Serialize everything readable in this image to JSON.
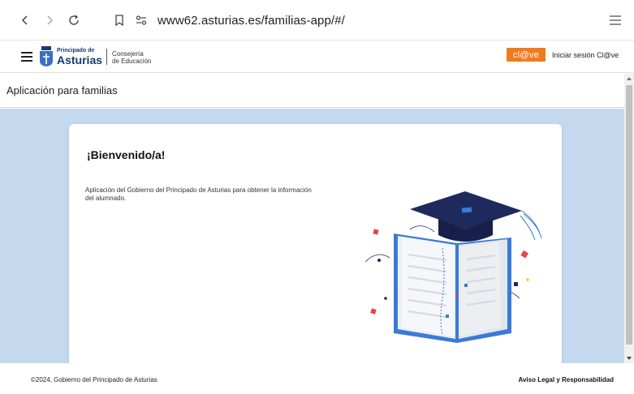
{
  "browser": {
    "url": "www62.asturias.es/familias-app/#/"
  },
  "header": {
    "logo_small": "Principado de",
    "logo_big": "Asturias",
    "department_line1": "Consejería",
    "department_line2": "de Educación",
    "clave_logo": "cl@ve",
    "login_label": "Iniciar sesión Cl@ve"
  },
  "page": {
    "title": "Aplicación para familias"
  },
  "welcome": {
    "title": "¡Bienvenido/a!",
    "description": "Aplicación del Gobierno del Principado de Asturias para obtener la información del alumnado."
  },
  "footer": {
    "copyright": "©2024, Gobierno del Principado de Asturias",
    "legal_link": "Aviso Legal y Responsabilidad"
  },
  "colors": {
    "content_background": "#c5d9ee",
    "clave_orange": "#f07b1f",
    "brand_navy": "#1a3a6b",
    "cap_navy": "#1e2a5c",
    "book_blue": "#3a7bd5"
  },
  "icons": {
    "back": "chevron-left-icon",
    "forward": "chevron-right-icon",
    "reload": "reload-icon",
    "bookmark": "bookmark-icon",
    "site_settings": "site-settings-icon",
    "menu": "menu-icon",
    "hamburger": "hamburger-icon",
    "shield": "asturias-shield-icon"
  }
}
